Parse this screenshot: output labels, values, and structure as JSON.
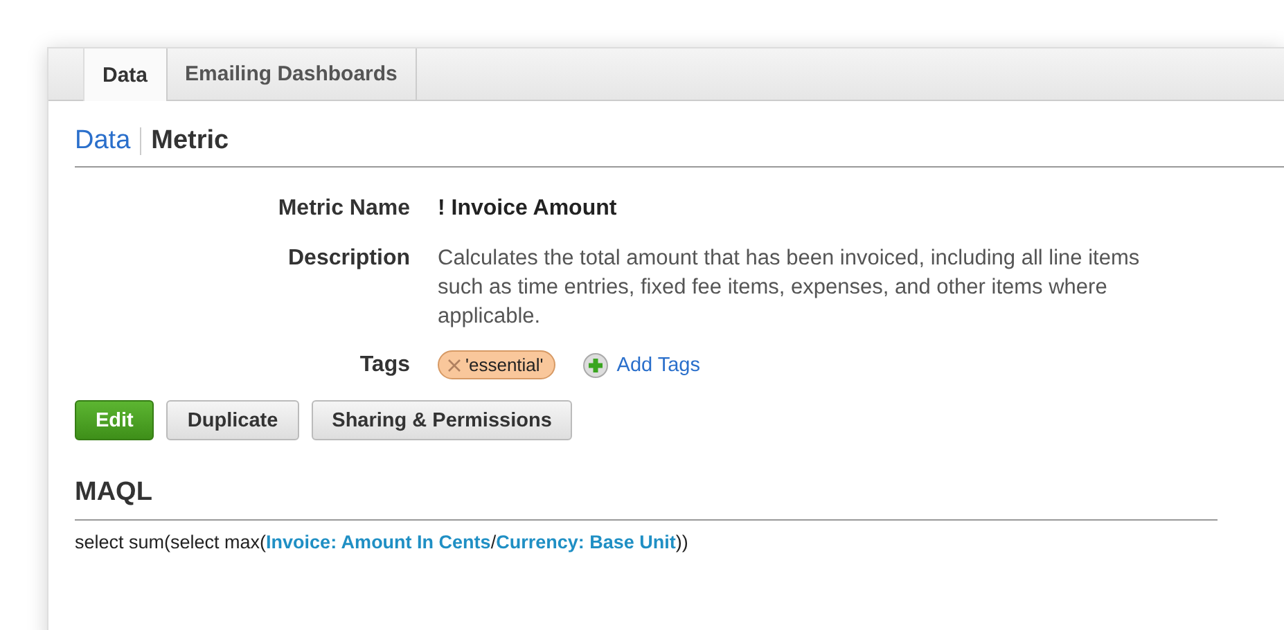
{
  "tabs": [
    {
      "label": "Data",
      "selected": true
    },
    {
      "label": "Emailing Dashboards",
      "selected": false
    }
  ],
  "breadcrumb": {
    "parent": "Data",
    "current": "Metric"
  },
  "fields": [
    {
      "label": "Metric Name",
      "kind": "title",
      "value": "! Invoice Amount"
    },
    {
      "label": "Description",
      "kind": "text",
      "value": "Calculates the total amount that has been invoiced, including all line items such as time entries, fixed fee items, expenses, and other items where applicable."
    },
    {
      "label": "Tags",
      "kind": "tags",
      "tags": [
        "'essential'"
      ],
      "add_label": "Add Tags"
    }
  ],
  "buttons": [
    {
      "label": "Edit",
      "kind": "primary"
    },
    {
      "label": "Duplicate",
      "kind": "default"
    },
    {
      "label": "Sharing & Permissions",
      "kind": "default"
    }
  ],
  "maql": {
    "heading": "MAQL",
    "segments": [
      {
        "kind": "text",
        "text": "select sum(select max("
      },
      {
        "kind": "link",
        "text": "Invoice: Amount In Cents"
      },
      {
        "kind": "text",
        "text": "/"
      },
      {
        "kind": "link",
        "text": "Currency: Base Unit"
      },
      {
        "kind": "text",
        "text": "))"
      }
    ]
  }
}
